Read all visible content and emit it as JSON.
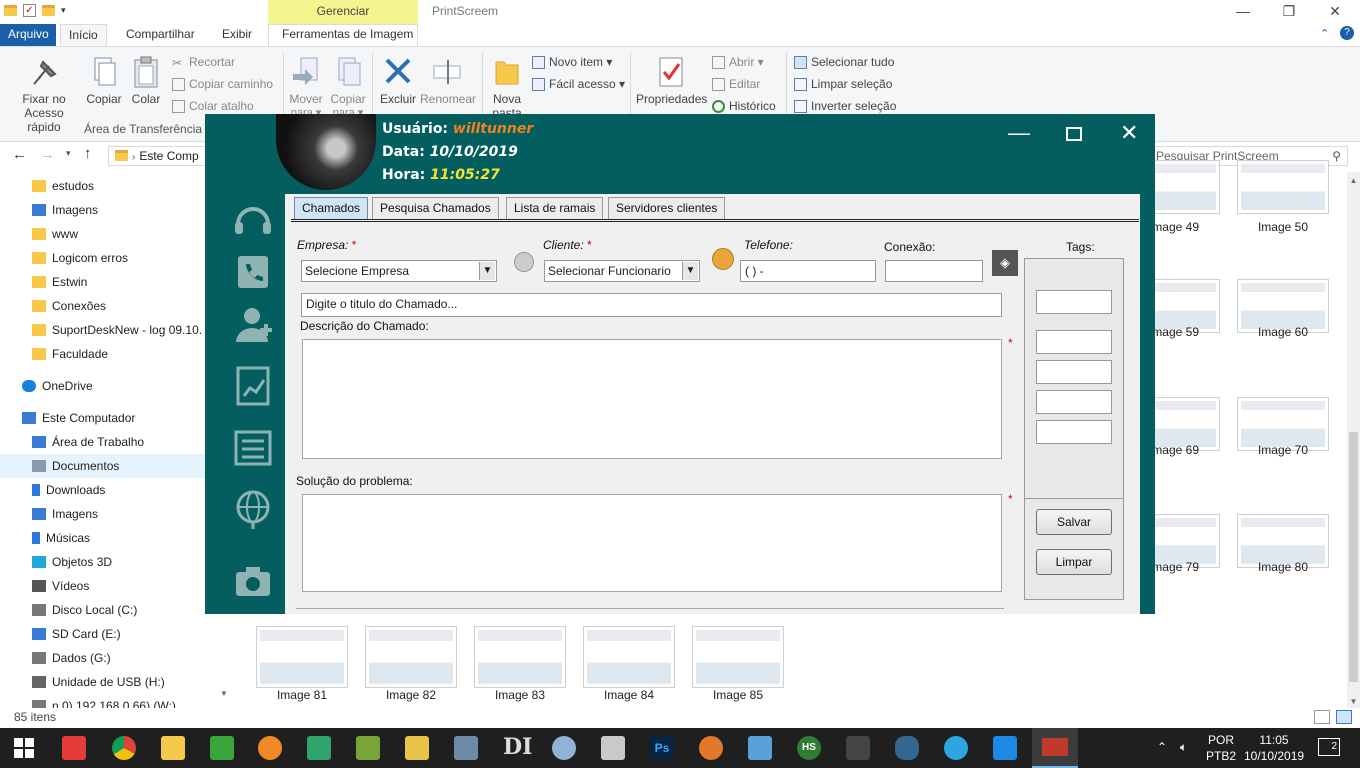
{
  "explorer": {
    "title": "PrintScreem",
    "context_tab": "Gerenciar",
    "window_controls": [
      "—",
      "❐",
      "✕"
    ],
    "ribbon_tabs": [
      "Arquivo",
      "Início",
      "Compartilhar",
      "Exibir",
      "Ferramentas de Imagem"
    ],
    "clipboard": {
      "pin_label_1": "Fixar no",
      "pin_label_2": "Acesso rápido",
      "copy": "Copiar",
      "paste": "Colar",
      "cut": "Recortar",
      "copy_path": "Copiar caminho",
      "paste_shortcut": "Colar atalho",
      "group": "Área de Transferência"
    },
    "organize": {
      "move": "Mover",
      "move_sub": "para ▾",
      "copy": "Copiar",
      "copy_sub": "para ▾",
      "delete": "Excluir",
      "rename": "Renomear"
    },
    "new": {
      "new_folder_1": "Nova",
      "new_folder_2": "pasta",
      "new_item": "Novo item ▾",
      "easy_access": "Fácil acesso ▾"
    },
    "open": {
      "properties": "Propriedades",
      "open": "Abrir ▾",
      "edit": "Editar",
      "history": "Histórico"
    },
    "select": {
      "select_all": "Selecionar tudo",
      "clear": "Limpar seleção",
      "invert": "Inverter seleção"
    },
    "address": "Este Comp",
    "search_placeholder": "Pesquisar PrintScreem",
    "nav_items": [
      {
        "label": "estudos"
      },
      {
        "label": "Imagens"
      },
      {
        "label": "www"
      },
      {
        "label": "Logicom erros"
      },
      {
        "label": "Estwin"
      },
      {
        "label": "Conexões"
      },
      {
        "label": "SuportDeskNew - log 09.10."
      },
      {
        "label": "Faculdade"
      },
      {
        "label": "OneDrive"
      },
      {
        "label": "Este Computador"
      },
      {
        "label": "Área de Trabalho"
      },
      {
        "label": "Documentos"
      },
      {
        "label": "Downloads"
      },
      {
        "label": "Imagens"
      },
      {
        "label": "Músicas"
      },
      {
        "label": "Objetos 3D"
      },
      {
        "label": "Vídeos"
      },
      {
        "label": "Disco Local (C:)"
      },
      {
        "label": "SD Card (E:)"
      },
      {
        "label": "Dados (G:)"
      },
      {
        "label": "Unidade de USB (H:)"
      },
      {
        "label": "n 0) 192.168.0.66) (W:)"
      }
    ],
    "status": "85 itens",
    "right_thumbs": [
      "Image 49",
      "Image 50",
      "Image 59",
      "Image 60",
      "Image 69",
      "Image 70",
      "Image 79",
      "Image 80"
    ],
    "bottom_thumbs": [
      "Image 81",
      "Image 82",
      "Image 83",
      "Image 84",
      "Image 85"
    ]
  },
  "app": {
    "user_label": "Usuário:",
    "user_value": "willtunner",
    "date_label": "Data:",
    "date_value": "10/10/2019",
    "time_label": "Hora:",
    "time_value": "11:05:27",
    "tabs": [
      "Chamados",
      "Pesquisa Chamados",
      "Lista de ramais",
      "Servidores clientes"
    ],
    "form": {
      "empresa_label": "Empresa:",
      "empresa_value": "Selecione Empresa",
      "cliente_label": "Cliente:",
      "cliente_value": "Selecionar Funcionario",
      "telefone_label": "Telefone:",
      "telefone_value": "( )     -",
      "conexao_label": "Conexão:",
      "conexao_value": "",
      "tags_label": "Tags:",
      "titulo_value": "Digite o titulo do Chamado...",
      "descricao_label": "Descrição do Chamado:",
      "solucao_label": "Solução do problema:",
      "required_mark": "*",
      "save": "Salvar",
      "clear": "Limpar"
    },
    "colors": {
      "bg": "#045e5f",
      "user": "#f0821e",
      "time": "#f2e530"
    }
  },
  "taskbar": {
    "lang_1": "POR",
    "lang_2": "PTB2",
    "time": "11:05",
    "date": "10/10/2019",
    "notif_count": "2"
  }
}
